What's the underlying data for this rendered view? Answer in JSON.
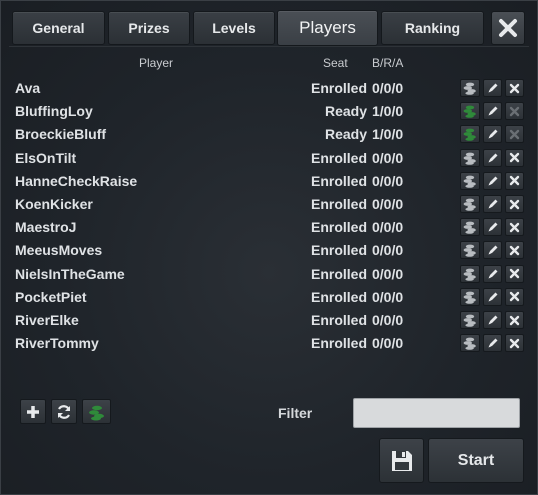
{
  "tabs": [
    "General",
    "Prizes",
    "Levels",
    "Players",
    "Ranking"
  ],
  "active_tab": "Players",
  "columns": {
    "player": "Player",
    "seat": "Seat",
    "bra": "B/R/A"
  },
  "players": [
    {
      "name": "Ava",
      "seat": "Enrolled",
      "bra": "0/0/0"
    },
    {
      "name": "BluffingLoy",
      "seat": "Ready",
      "bra": "1/0/0"
    },
    {
      "name": "BroeckieBluff",
      "seat": "Ready",
      "bra": "1/0/0"
    },
    {
      "name": "ElsOnTilt",
      "seat": "Enrolled",
      "bra": "0/0/0"
    },
    {
      "name": "HanneCheckRaise",
      "seat": "Enrolled",
      "bra": "0/0/0"
    },
    {
      "name": "KoenKicker",
      "seat": "Enrolled",
      "bra": "0/0/0"
    },
    {
      "name": "MaestroJ",
      "seat": "Enrolled",
      "bra": "0/0/0"
    },
    {
      "name": "MeeusMoves",
      "seat": "Enrolled",
      "bra": "0/0/0"
    },
    {
      "name": "NielsInTheGame",
      "seat": "Enrolled",
      "bra": "0/0/0"
    },
    {
      "name": "PocketPiet",
      "seat": "Enrolled",
      "bra": "0/0/0"
    },
    {
      "name": "RiverElke",
      "seat": "Enrolled",
      "bra": "0/0/0"
    },
    {
      "name": "RiverTommy",
      "seat": "Enrolled",
      "bra": "0/0/0"
    }
  ],
  "row_icons": [
    "chip-stack-icon",
    "pencil-icon",
    "close-icon"
  ],
  "bottom_icons": [
    "plus-icon",
    "refresh-icon",
    "chip-stack-icon"
  ],
  "filter": {
    "label": "Filter",
    "value": "",
    "placeholder": ""
  },
  "actions": {
    "save_icon": "floppy-disk-icon",
    "start_label": "Start"
  },
  "colors": {
    "chip_green": "#2f8a3a",
    "chip_grey": "#b8bcc0",
    "text": "#dfe2e5"
  }
}
